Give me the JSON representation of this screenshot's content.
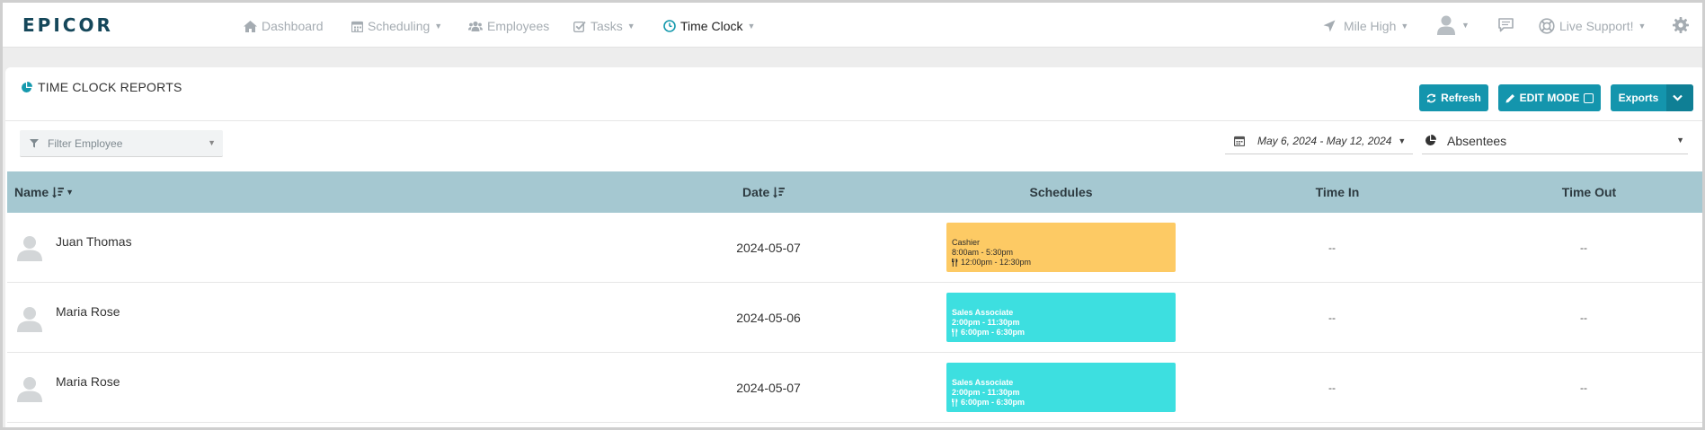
{
  "app": {
    "brand": "EPICOR"
  },
  "nav": {
    "items": [
      {
        "label": "Dashboard",
        "icon": "home-icon",
        "dropdown": false
      },
      {
        "label": "Scheduling",
        "icon": "calendar-icon",
        "dropdown": true
      },
      {
        "label": "Employees",
        "icon": "users-icon",
        "dropdown": false
      },
      {
        "label": "Tasks",
        "icon": "check-square-icon",
        "dropdown": true
      },
      {
        "label": "Time Clock",
        "icon": "clock-icon",
        "dropdown": true,
        "active": true
      }
    ],
    "location": "Mile High",
    "support": "Live Support!",
    "right_icons": [
      "user-avatar-icon",
      "chat-icon",
      "lifebuoy-icon",
      "gear-icon"
    ]
  },
  "panel": {
    "title": "TIME CLOCK REPORTS",
    "buttons": {
      "refresh": "Refresh",
      "edit_mode": "EDIT MODE",
      "exports": "Exports"
    },
    "filter": {
      "placeholder": "Filter Employee"
    },
    "date_range": "May 6, 2024 - May 12, 2024",
    "report_type": "Absentees"
  },
  "table": {
    "columns": {
      "name": "Name",
      "date": "Date",
      "schedules": "Schedules",
      "time_in": "Time In",
      "time_out": "Time Out"
    },
    "rows": [
      {
        "name": "Juan Thomas",
        "date": "2024-05-07",
        "shift_role": "Cashier",
        "shift_time": "8:00am - 5:30pm",
        "shift_meal": "12:00pm - 12:30pm",
        "shift_color": "#fdca64",
        "time_in": "--",
        "time_out": "--"
      },
      {
        "name": "Maria Rose",
        "date": "2024-05-06",
        "shift_role": "Sales Associate",
        "shift_time": "2:00pm - 11:30pm",
        "shift_meal": "6:00pm - 6:30pm",
        "shift_color": "#3ddfe0",
        "time_in": "--",
        "time_out": "--"
      },
      {
        "name": "Maria Rose",
        "date": "2024-05-07",
        "shift_role": "Sales Associate",
        "shift_time": "2:00pm - 11:30pm",
        "shift_meal": "6:00pm - 6:30pm",
        "shift_color": "#3ddfe0",
        "time_in": "--",
        "time_out": "--"
      }
    ]
  },
  "colors": {
    "accent": "#1495ad",
    "header_bg": "#a5c8d1",
    "brand": "#15475a"
  }
}
